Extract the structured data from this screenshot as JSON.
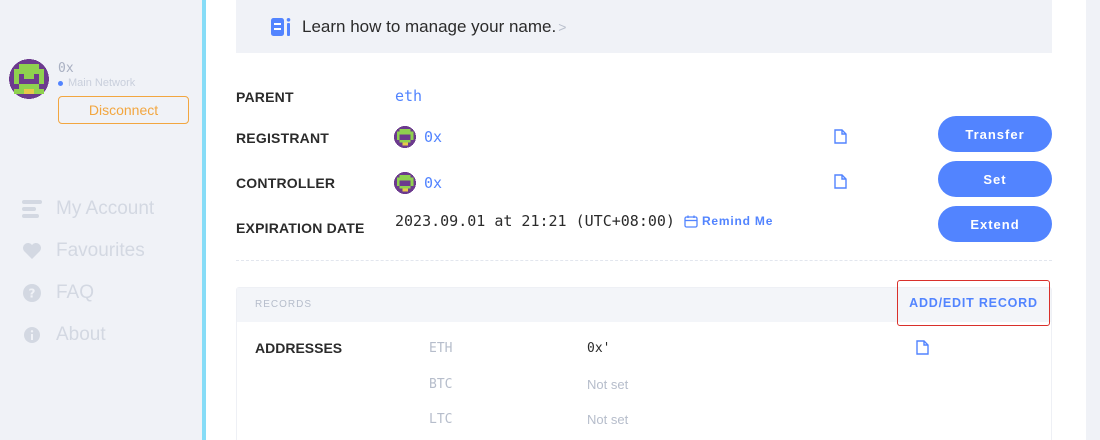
{
  "sidebar": {
    "account_name": "0x",
    "network": "Main Network",
    "disconnect_label": "Disconnect",
    "nav": [
      {
        "label": "My Account",
        "icon": "account-icon"
      },
      {
        "label": "Favourites",
        "icon": "heart-icon"
      },
      {
        "label": "FAQ",
        "icon": "question-icon"
      },
      {
        "label": "About",
        "icon": "info-icon"
      }
    ]
  },
  "banner": {
    "text": "Learn how to manage your name.",
    "chevron": ">"
  },
  "details": {
    "parent_label": "PARENT",
    "parent_value": "eth",
    "registrant_label": "REGISTRANT",
    "registrant_value": "0x",
    "controller_label": "CONTROLLER",
    "controller_value": "0x",
    "expiration_label": "EXPIRATION DATE",
    "expiration_value": "2023.09.01 at 21:21 (UTC+08:00)",
    "remind_label": "Remind Me"
  },
  "actions": {
    "transfer": "Transfer",
    "set": "Set",
    "extend": "Extend"
  },
  "records": {
    "title": "RECORDS",
    "add_edit_label": "ADD/EDIT RECORD",
    "addresses_label": "ADDRESSES",
    "items": [
      {
        "coin": "ETH",
        "value": "0x'"
      },
      {
        "coin": "BTC",
        "value": "Not set"
      },
      {
        "coin": "LTC",
        "value": "Not set"
      }
    ]
  },
  "colors": {
    "accent": "#5284ff",
    "warning": "#f2a640",
    "highlight_border": "#d9302b",
    "sidebar_rule": "#86dcf7"
  }
}
